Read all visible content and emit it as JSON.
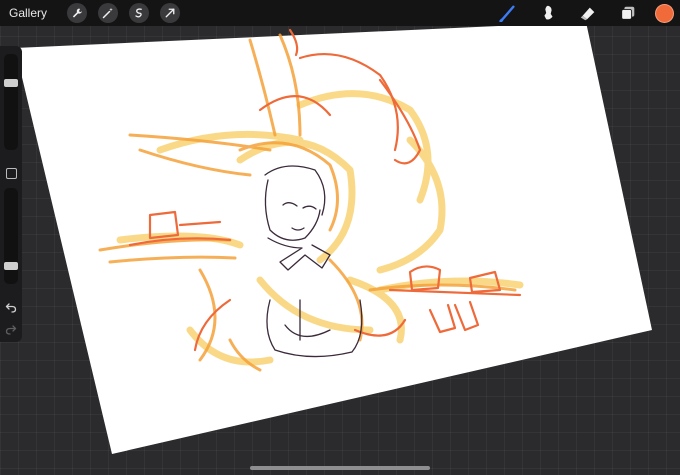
{
  "topbar": {
    "gallery_label": "Gallery",
    "left_tools": [
      {
        "icon": "wrench-icon",
        "name": "actions"
      },
      {
        "icon": "magic-wand-icon",
        "name": "adjustments"
      },
      {
        "icon": "selection-icon",
        "name": "selection"
      },
      {
        "icon": "transform-arrow-icon",
        "name": "transform"
      }
    ],
    "right_tools": [
      {
        "icon": "brush-icon",
        "name": "paint",
        "active": true
      },
      {
        "icon": "smudge-icon",
        "name": "smudge"
      },
      {
        "icon": "eraser-icon",
        "name": "eraser"
      },
      {
        "icon": "layers-icon",
        "name": "layers"
      }
    ],
    "active_tool_color": "#3d7cf5",
    "current_color": "#f06a3a"
  },
  "sidebar": {
    "brush_size_level": 0.72,
    "opacity_level": 0.16
  },
  "canvas": {
    "paper_color": "#ffffff",
    "sketch_colors": [
      "#f7c64a",
      "#f5a23a",
      "#ee6a3a",
      "#3a2a3a"
    ]
  }
}
